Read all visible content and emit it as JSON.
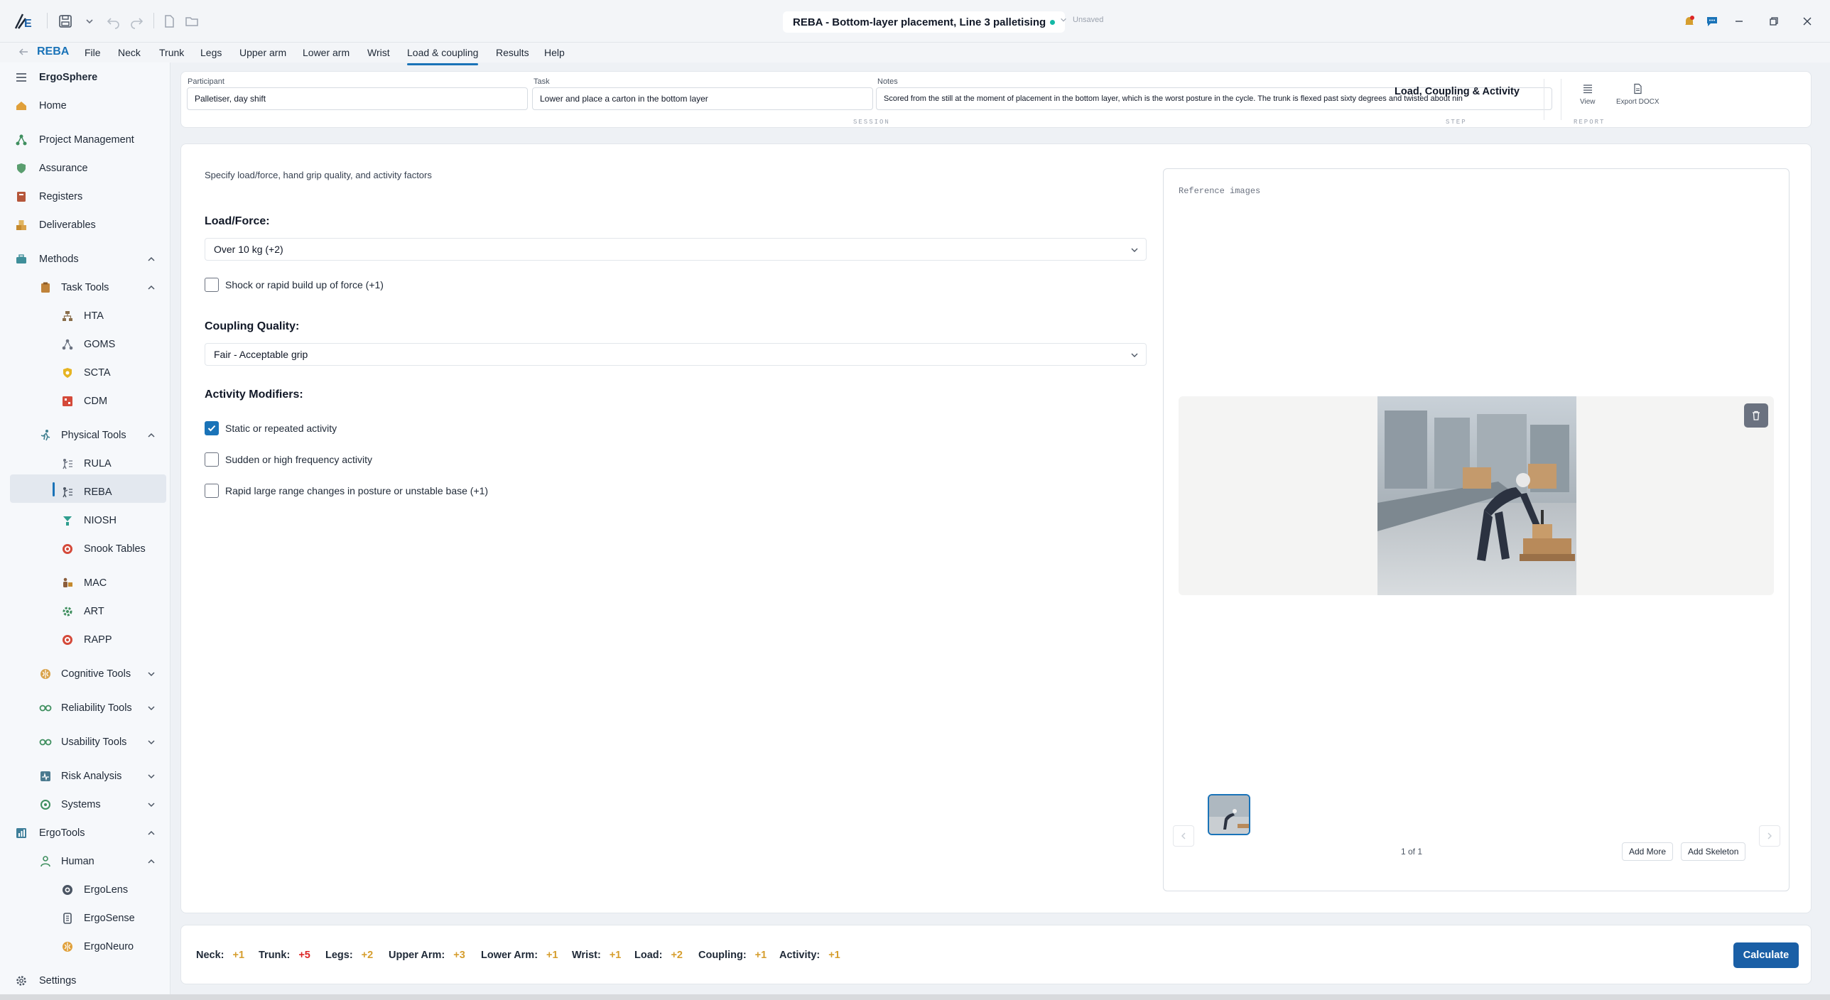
{
  "titlebar": {
    "title": "REBA - Bottom-layer placement, Line 3 palletising",
    "status": "Unsaved"
  },
  "menubar": {
    "app_name": "REBA",
    "items": [
      "File",
      "Neck",
      "Trunk",
      "Legs",
      "Upper arm",
      "Lower arm",
      "Wrist",
      "Load & coupling",
      "Results",
      "Help"
    ],
    "active": "Load & coupling"
  },
  "sidebar": {
    "brand": "ErgoSphere",
    "items": {
      "home": "Home",
      "project_management": "Project Management",
      "assurance": "Assurance",
      "registers": "Registers",
      "deliverables": "Deliverables",
      "methods": "Methods",
      "task_tools": "Task Tools",
      "hta": "HTA",
      "goms": "GOMS",
      "scta": "SCTA",
      "cdm": "CDM",
      "physical_tools": "Physical Tools",
      "rula": "RULA",
      "reba": "REBA",
      "niosh": "NIOSH",
      "snook": "Snook Tables",
      "mac": "MAC",
      "art": "ART",
      "rapp": "RAPP",
      "cognitive_tools": "Cognitive Tools",
      "reliability_tools": "Reliability Tools",
      "usability_tools": "Usability Tools",
      "risk_analysis": "Risk Analysis",
      "systems": "Systems",
      "ergotools": "ErgoTools",
      "human": "Human",
      "ergolens": "ErgoLens",
      "ergosense": "ErgoSense",
      "ergoneuro": "ErgoNeuro",
      "settings": "Settings"
    },
    "active": "REBA"
  },
  "session": {
    "participant_label": "Participant",
    "participant_value": "Palletiser, day shift",
    "task_label": "Task",
    "task_value": "Lower and place a carton in the bottom layer",
    "notes_label": "Notes",
    "notes_value": "Scored from the still at the moment of placement in the bottom layer, which is the worst posture in the cycle. The trunk is flexed past sixty degrees and twisted about nin",
    "session_caption": "SESSION",
    "step_title": "Load, Coupling & Activity",
    "step_caption": "STEP",
    "view_label": "View",
    "export_label": "Export DOCX",
    "report_caption": "REPORT"
  },
  "form": {
    "intro": "Specify load/force, hand grip quality, and activity factors",
    "load_heading": "Load/Force:",
    "load_value": "Over 10 kg (+2)",
    "shock_label": "Shock or rapid build up of force (+1)",
    "shock_checked": false,
    "coupling_heading": "Coupling Quality:",
    "coupling_value": "Fair - Acceptable grip",
    "activity_heading": "Activity Modifiers:",
    "static_label": "Static or repeated activity",
    "static_checked": true,
    "sudden_label": "Sudden or high frequency activity",
    "sudden_checked": false,
    "rapid_label": "Rapid large range changes in posture or unstable base (+1)",
    "rapid_checked": false
  },
  "reference": {
    "title": "Reference images",
    "counter": "1 of 1",
    "add_more": "Add More",
    "add_skeleton": "Add Skeleton"
  },
  "scores": [
    {
      "label": "Neck:",
      "value": "+1",
      "color": "#d69e2e"
    },
    {
      "label": "Trunk:",
      "value": "+5",
      "color": "#dc2626"
    },
    {
      "label": "Legs:",
      "value": "+2",
      "color": "#d69e2e"
    },
    {
      "label": "Upper Arm:",
      "value": "+3",
      "color": "#d69e2e"
    },
    {
      "label": "Lower Arm:",
      "value": "+1",
      "color": "#d69e2e"
    },
    {
      "label": "Wrist:",
      "value": "+1",
      "color": "#d69e2e"
    },
    {
      "label": "Load:",
      "value": "+2",
      "color": "#d69e2e"
    },
    {
      "label": "Coupling:",
      "value": "+1",
      "color": "#d69e2e"
    },
    {
      "label": "Activity:",
      "value": "+1",
      "color": "#d69e2e"
    }
  ],
  "calculate_label": "Calculate",
  "colors": {
    "accent": "#1a73b8",
    "primary_button": "#1a5fa6"
  }
}
